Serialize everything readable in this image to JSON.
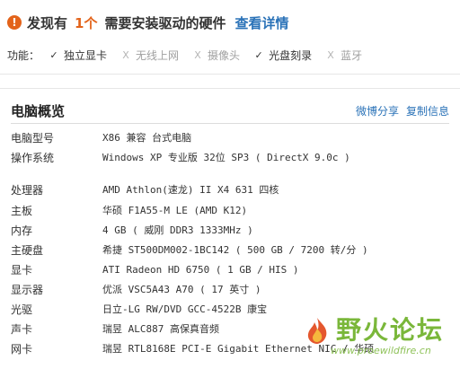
{
  "alert": {
    "prefix": "发现有",
    "count": "1个",
    "message": "需要安装驱动的硬件",
    "link": "查看详情",
    "icon": "warning-icon"
  },
  "features": {
    "label": "功能：",
    "items": [
      {
        "name": "独立显卡",
        "enabled": true
      },
      {
        "name": "无线上网",
        "enabled": false
      },
      {
        "name": "摄像头",
        "enabled": false
      },
      {
        "name": "光盘刻录",
        "enabled": true
      },
      {
        "name": "蓝牙",
        "enabled": false
      }
    ]
  },
  "panel": {
    "title": "电脑概览",
    "share": "微博分享",
    "copy": "复制信息"
  },
  "specs": [
    {
      "key": "电脑型号",
      "value": "X86 兼容 台式电脑"
    },
    {
      "key": "操作系统",
      "value": "Windows XP 专业版 32位 SP3 ( DirectX 9.0c )"
    },
    {
      "key": "处理器",
      "value": "AMD Athlon(速龙) II X4 631 四核"
    },
    {
      "key": "主板",
      "value": "华硕 F1A55-M LE (AMD K12)"
    },
    {
      "key": "内存",
      "value": "4 GB ( 威刚 DDR3 1333MHz )"
    },
    {
      "key": "主硬盘",
      "value": "希捷 ST500DM002-1BC142 ( 500 GB / 7200 转/分 )"
    },
    {
      "key": "显卡",
      "value": "ATI Radeon HD 6750  ( 1 GB / HIS )"
    },
    {
      "key": "显示器",
      "value": "优派 VSC5A43 A70 ( 17 英寸 )"
    },
    {
      "key": "光驱",
      "value": "日立-LG RW/DVD GCC-4522B 康宝"
    },
    {
      "key": "声卡",
      "value": "瑞昱 ALC887 高保真音频"
    },
    {
      "key": "网卡",
      "value": "瑞昱 RTL8168E PCI-E Gigabit Ethernet NIC / 华硕"
    }
  ],
  "watermark": {
    "title": "野火论坛",
    "url": "www.proewildfire.cn"
  },
  "colors": {
    "accent_orange": "#e3631a",
    "link_blue": "#2b73b8",
    "watermark_green": "#7ab73a"
  }
}
